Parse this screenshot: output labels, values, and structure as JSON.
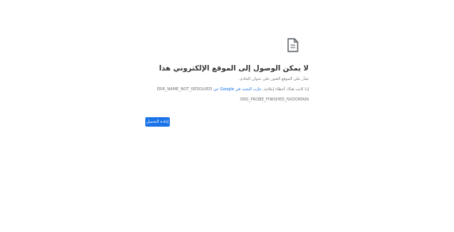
{
  "page": {
    "icon": "document-icon",
    "heading": "لا يمكن الوصول إلى الموقع الإلكتروني هذا",
    "line1": "تعذّر على الموقع العثور على عنوان الخادم.",
    "line2_prefix": "إذا كانت هناك أخطاء إملائية،",
    "line2_link": "جرِّب البحث في Google عن",
    "line2_code": "ERR_NAME_NOT_RESOLVED",
    "line3": "DNS_PROBE_FINISHED_NXDOMAIN",
    "reload_label": "إعادة التحميل"
  },
  "colors": {
    "accent": "#1a73e8",
    "heading": "#333333",
    "body_text": "#70757a"
  }
}
